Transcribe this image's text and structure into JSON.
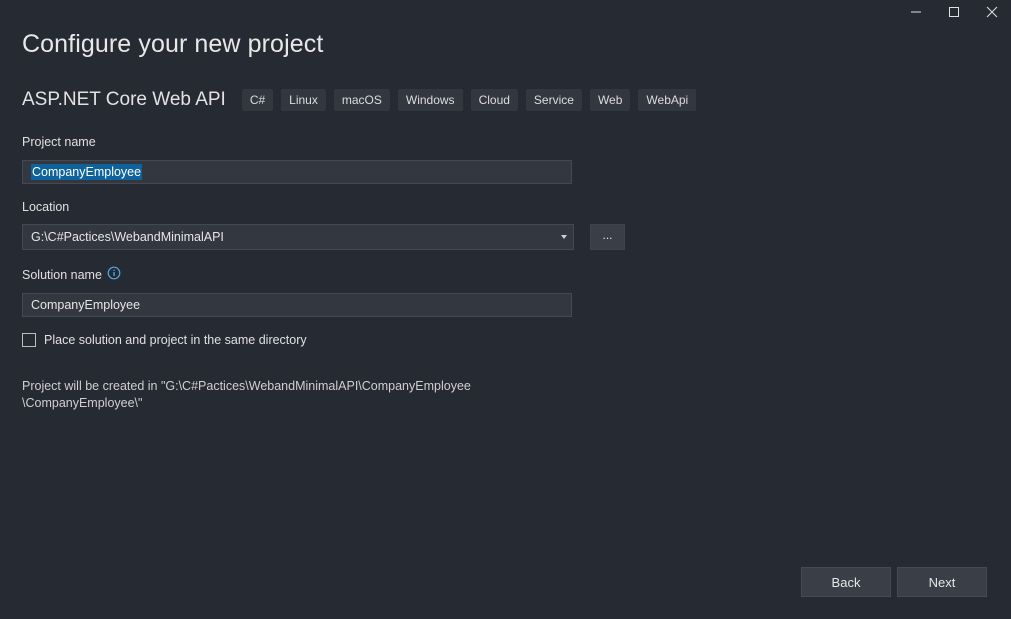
{
  "window": {
    "controls": [
      "minimize-icon",
      "maximize-icon",
      "close-icon"
    ]
  },
  "page": {
    "title": "Configure your new project"
  },
  "template": {
    "name": "ASP.NET Core Web API",
    "tags": [
      "C#",
      "Linux",
      "macOS",
      "Windows",
      "Cloud",
      "Service",
      "Web",
      "WebApi"
    ]
  },
  "project_name": {
    "label": "Project name",
    "value": "CompanyEmployee"
  },
  "location": {
    "label": "Location",
    "value": "G:\\C#Pactices\\WebandMinimalAPI",
    "browse_label": "..."
  },
  "solution_name": {
    "label": "Solution name",
    "value": "CompanyEmployee"
  },
  "same_directory": {
    "label": "Place solution and project in the same directory",
    "checked": false
  },
  "info": {
    "line1": "Project will be created in \"G:\\C#Pactices\\WebandMinimalAPI\\CompanyEmployee",
    "line2": "\\CompanyEmployee\\\""
  },
  "footer": {
    "back_label": "Back",
    "next_label": "Next"
  },
  "colors": {
    "background": "#262a33",
    "input_background": "#333740",
    "selection": "#0e639c",
    "info_icon": "#4fa8e0"
  }
}
